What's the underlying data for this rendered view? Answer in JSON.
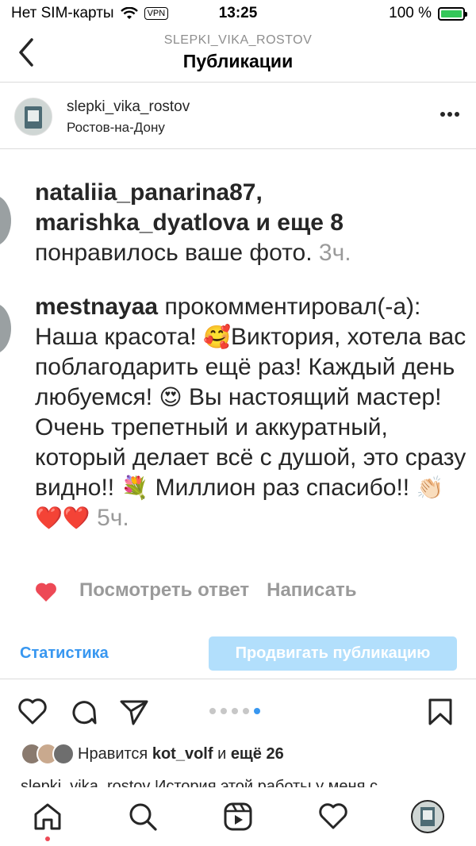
{
  "status_bar": {
    "carrier": "Нет SIM-карты",
    "vpn": "VPN",
    "time": "13:25",
    "battery": "100 %"
  },
  "nav": {
    "account": "SLEPKI_VIKA_ROSTOV",
    "title": "Публикации"
  },
  "post": {
    "username": "slepki_vika_rostov",
    "location": "Ростов-на-Дону"
  },
  "image_content": {
    "like_users_line1": "nataliia_panarina87,",
    "like_users_line2_user": "marishka_dyatlova",
    "like_users_line2_rest": " и еще 8",
    "like_action": "понравилось ваше фото.",
    "like_time": "3ч.",
    "comment_user": "mestnayaa",
    "comment_part1": " прокомментировал(-а): Наша красота! ",
    "comment_emoji1": "🥰",
    "comment_part2": "Виктория, хотела вас поблагодарить ещё раз! Каждый день любуемся! ",
    "comment_emoji2": "😍",
    "comment_part3": " Вы настоящий мастер! Очень трепетный и аккуратный, который делает всё с душой,  это сразу видно!! ",
    "comment_emoji3": "💐",
    "comment_part4": "  Миллион раз спасибо!! ",
    "comment_emoji4": "👏🏻❤️❤️",
    "comment_time": "5ч.",
    "view_reply": "Посмотреть ответ",
    "write": "Написать"
  },
  "stats": {
    "statistics_label": "Статистика",
    "promote_label": "Продвигать публикацию"
  },
  "carousel": {
    "count": 5,
    "active_index": 4
  },
  "likes": {
    "prefix": "Нравится ",
    "user": "kot_volf",
    "middle": " и ",
    "count": "ещё 26"
  },
  "caption_peek": "slepki_vika_rostov История этой работы у меня с",
  "colors": {
    "link_blue": "#3897f0",
    "promote_bg": "#b2dffc",
    "like_red": "#ed4956",
    "battery_green": "#34c759"
  }
}
